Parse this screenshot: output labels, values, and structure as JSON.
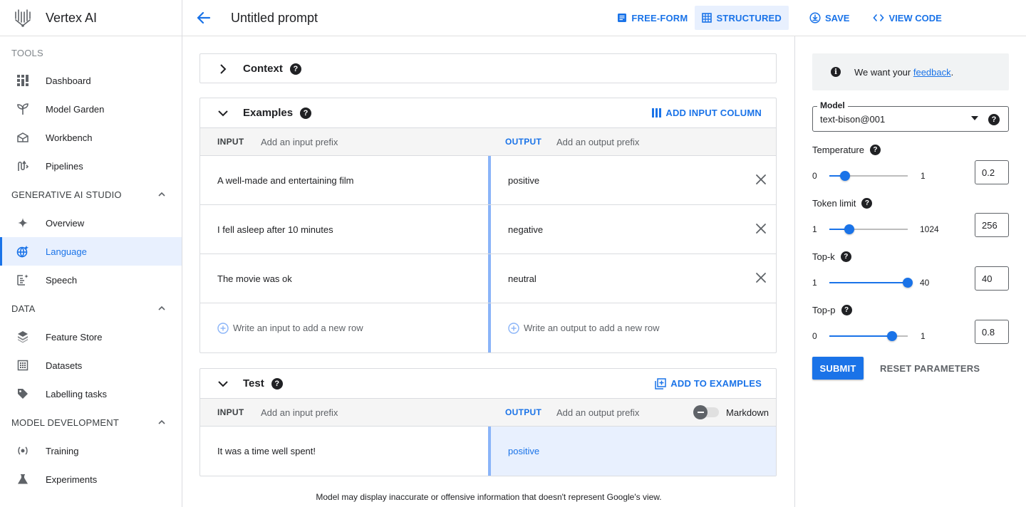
{
  "app": {
    "name": "Vertex AI"
  },
  "sidebar": {
    "tools_label": "TOOLS",
    "tools": [
      {
        "label": "Dashboard",
        "icon": "dashboard-icon"
      },
      {
        "label": "Model Garden",
        "icon": "model-garden-icon"
      },
      {
        "label": "Workbench",
        "icon": "workbench-icon"
      },
      {
        "label": "Pipelines",
        "icon": "pipelines-icon"
      }
    ],
    "sections": [
      {
        "label": "GENERATIVE AI STUDIO",
        "items": [
          {
            "label": "Overview",
            "icon": "sparkle-icon"
          },
          {
            "label": "Language",
            "icon": "language-icon",
            "active": true
          },
          {
            "label": "Speech",
            "icon": "speech-icon"
          }
        ]
      },
      {
        "label": "DATA",
        "items": [
          {
            "label": "Feature Store",
            "icon": "feature-store-icon"
          },
          {
            "label": "Datasets",
            "icon": "datasets-icon"
          },
          {
            "label": "Labelling tasks",
            "icon": "label-tag-icon"
          }
        ]
      },
      {
        "label": "MODEL DEVELOPMENT",
        "items": [
          {
            "label": "Training",
            "icon": "training-icon"
          },
          {
            "label": "Experiments",
            "icon": "flask-icon"
          }
        ]
      }
    ]
  },
  "header": {
    "title": "Untitled prompt",
    "freeform_label": "FREE-FORM",
    "structured_label": "STRUCTURED",
    "save_label": "SAVE",
    "view_code_label": "VIEW CODE"
  },
  "context": {
    "title": "Context"
  },
  "examples": {
    "title": "Examples",
    "add_column_label": "ADD INPUT COLUMN",
    "input_label": "INPUT",
    "input_prefix_placeholder": "Add an input prefix",
    "output_label": "OUTPUT",
    "output_prefix_placeholder": "Add an output prefix",
    "rows": [
      {
        "input": "A well-made and entertaining film",
        "output": "positive"
      },
      {
        "input": "I fell asleep after 10 minutes",
        "output": "negative"
      },
      {
        "input": "The movie was ok",
        "output": "neutral"
      }
    ],
    "new_input_placeholder": "Write an input to add a new row",
    "new_output_placeholder": "Write an output to add a new row"
  },
  "test": {
    "title": "Test",
    "add_to_examples_label": "ADD TO EXAMPLES",
    "input_label": "INPUT",
    "input_prefix_placeholder": "Add an input prefix",
    "output_label": "OUTPUT",
    "output_prefix_placeholder": "Add an output prefix",
    "markdown_label": "Markdown",
    "markdown_enabled": false,
    "input": "It was a time well spent!",
    "output": "positive"
  },
  "disclaimer": "Model may display inaccurate or offensive information that doesn't represent Google's view.",
  "settings": {
    "feedback_prefix": "We want your ",
    "feedback_link": "feedback",
    "feedback_suffix": ".",
    "model_label": "Model",
    "model_value": "text-bison@001",
    "params": [
      {
        "label": "Temperature",
        "min": "0",
        "max": "1",
        "value": "0.2",
        "fraction": 0.2
      },
      {
        "label": "Token limit",
        "min": "1",
        "max": "1024",
        "value": "256",
        "fraction": 0.25
      },
      {
        "label": "Top-k",
        "min": "1",
        "max": "40",
        "value": "40",
        "fraction": 1.0
      },
      {
        "label": "Top-p",
        "min": "0",
        "max": "1",
        "value": "0.8",
        "fraction": 0.8
      }
    ],
    "submit_label": "SUBMIT",
    "reset_label": "RESET PARAMETERS"
  },
  "colors": {
    "accent": "#1a73e8",
    "accent_light": "#e8f0fe",
    "divider": "#8ab4f8"
  }
}
